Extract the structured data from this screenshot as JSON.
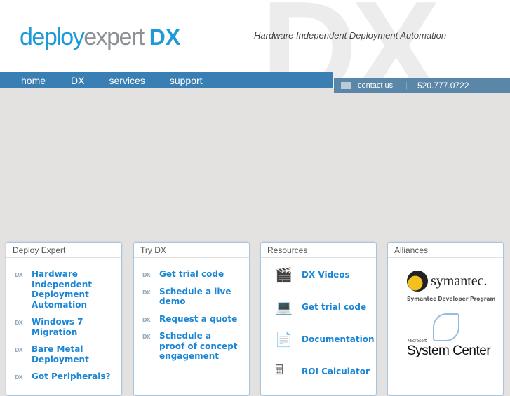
{
  "header": {
    "logo_part1": "deploy",
    "logo_part2": "expert",
    "logo_part3": "DX",
    "watermark": "DX",
    "tagline": "Hardware Independent Deployment Automation"
  },
  "nav": [
    "home",
    "DX",
    "services",
    "support"
  ],
  "contact": {
    "label": "contact us",
    "separator": "|",
    "phone": "520.777.0722"
  },
  "panels": {
    "deploy": {
      "title": "Deploy Expert",
      "items": [
        "Hardware Independent Deployment Automation",
        "Windows 7 Migration",
        "Bare Metal Deployment",
        "Got Peripherals?"
      ]
    },
    "try": {
      "title": "Try DX",
      "items": [
        "Get trial code",
        "Schedule a live demo",
        "Request a quote",
        "Schedule a proof of concept engagement"
      ]
    },
    "resources": {
      "title": "Resources",
      "items": [
        {
          "icon": "video-clapper-icon",
          "label": "DX Videos"
        },
        {
          "icon": "computer-icon",
          "label": "Get trial code"
        },
        {
          "icon": "document-icon",
          "label": "Documentation"
        },
        {
          "icon": "calculator-icon",
          "label": "ROI Calculator"
        }
      ]
    },
    "alliances": {
      "title": "Alliances",
      "symantec": "symantec.",
      "symantec_sub": "Symantec Developer Program",
      "ms_small": "Microsoft",
      "ms_big": "System Center"
    }
  },
  "item_icon": "DX"
}
